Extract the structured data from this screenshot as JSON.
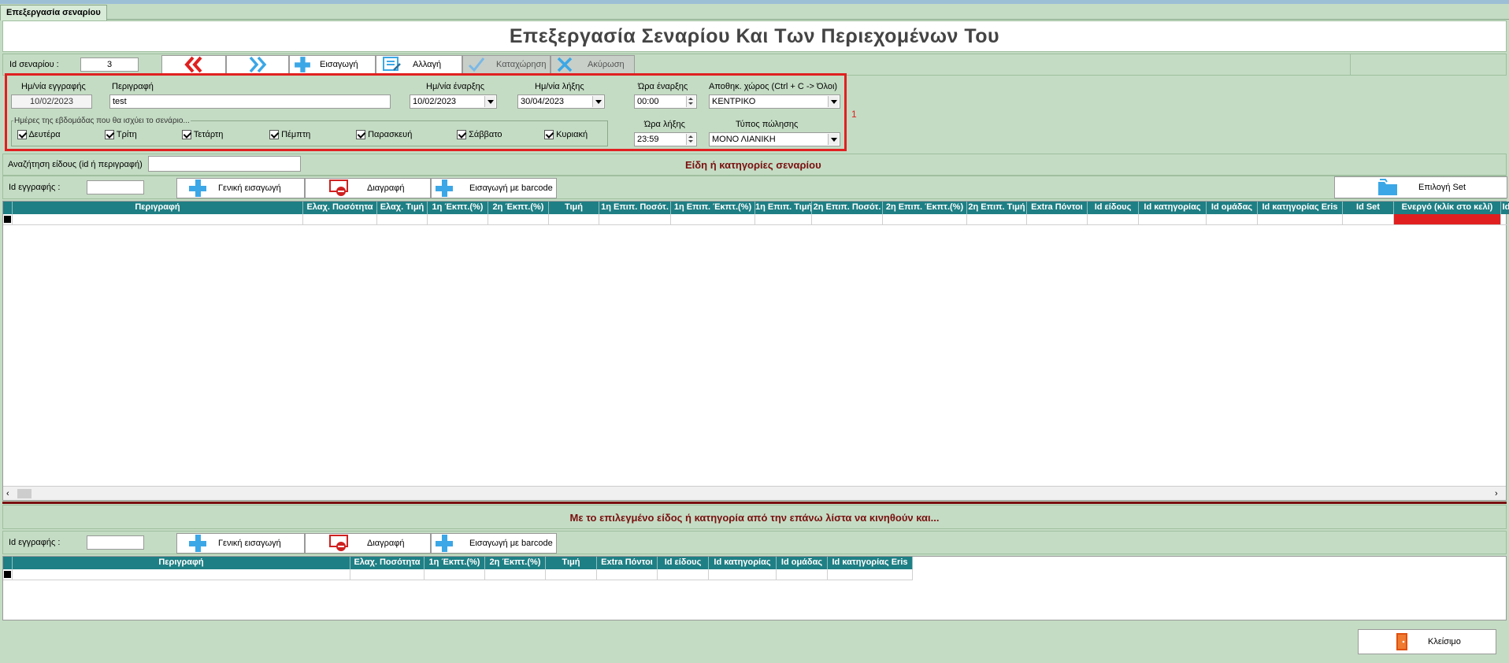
{
  "tab": {
    "label": "Επεξεργασία σεναρίου"
  },
  "title": "Επεξεργασία Σεναρίου Και Των Περιεχομένων Του",
  "toolbar": {
    "id_label": "Id σεναρίου :",
    "id_value": "3",
    "insert": "Εισαγωγή",
    "change": "Αλλαγή",
    "save": "Καταχώρηση",
    "cancel": "Ακύρωση"
  },
  "form": {
    "reg_date_label": "Ημ/νία εγγραφής",
    "reg_date_value": "10/02/2023",
    "desc_label": "Περιγραφή",
    "desc_value": "test",
    "start_date_label": "Ημ/νία έναρξης",
    "start_date_value": "10/02/2023",
    "end_date_label": "Ημ/νία λήξης",
    "end_date_value": "30/04/2023",
    "start_time_label": "Ώρα έναρξης",
    "start_time_value": "00:00",
    "end_time_label": "Ώρα λήξης",
    "end_time_value": "23:59",
    "storage_label": "Αποθηκ. χώρος (Ctrl + C ->  Όλοι)",
    "storage_value": "ΚΕΝΤΡΙΚΟ",
    "sale_type_label": "Τύπος πώλησης",
    "sale_type_value": "ΜΟΝΟ ΛΙΑΝΙΚΗ",
    "days_legend": "Ημέρες της εβδομάδας που θα ισχύει το σενάριο...",
    "days": [
      "Δευτέρα",
      "Τρίτη",
      "Τετάρτη",
      "Πέμπτη",
      "Παρασκευή",
      "Σάββατο",
      "Κυριακή"
    ],
    "annotation": "1"
  },
  "items": {
    "search_label": "Αναζήτηση είδους (id ή περιγραφή)",
    "section_title": "Είδη ή κατηγορίες σεναρίου",
    "id_reg_label": "Id εγγραφής :",
    "general_insert": "Γενική εισαγωγή",
    "delete": "Διαγραφή",
    "barcode_insert": "Εισαγωγή με barcode",
    "select_set": "Επιλογή Set",
    "columns": [
      "Περιγραφή",
      "Ελαχ. Ποσότητα",
      "Ελαχ. Τιμή",
      "1η Έκπτ.(%)",
      "2η Έκπτ.(%)",
      "Τιμή",
      "1η Επιπ. Ποσότ.",
      "1η Επιπ. Έκπτ.(%)",
      "1η Επιπ. Τιμή",
      "2η Επιπ. Ποσότ.",
      "2η Επιπ. Έκπτ.(%)",
      "2η Επιπ. Τιμή",
      "Extra Πόντοι",
      "Id είδους",
      "Id κατηγορίας",
      "Id ομάδας",
      "Id κατηγορίας Eris",
      "Id Set",
      "Ενεργό (κλίκ στο κελί)",
      "Id"
    ]
  },
  "related": {
    "section_title": "Με το επιλεγμένο είδος ή κατηγορία από την επάνω λίστα να κινηθούν και...",
    "id_reg_label": "Id εγγραφής :",
    "general_insert": "Γενική εισαγωγή",
    "delete": "Διαγραφή",
    "barcode_insert": "Εισαγωγή με barcode",
    "columns": [
      "Περιγραφή",
      "Ελαχ. Ποσότητα",
      "1η Έκπτ.(%)",
      "2η Έκπτ.(%)",
      "Τιμή",
      "Extra Πόντοι",
      "Id είδους",
      "Id κατηγορίας",
      "Id ομάδας",
      "Id κατηγορίας Eris"
    ]
  },
  "footer": {
    "close": "Κλείσιμο"
  },
  "colors": {
    "background": "#c4dcc4",
    "grid_header": "#1e7f84",
    "highlight_red": "#e02020",
    "section_title": "#7a1010"
  }
}
